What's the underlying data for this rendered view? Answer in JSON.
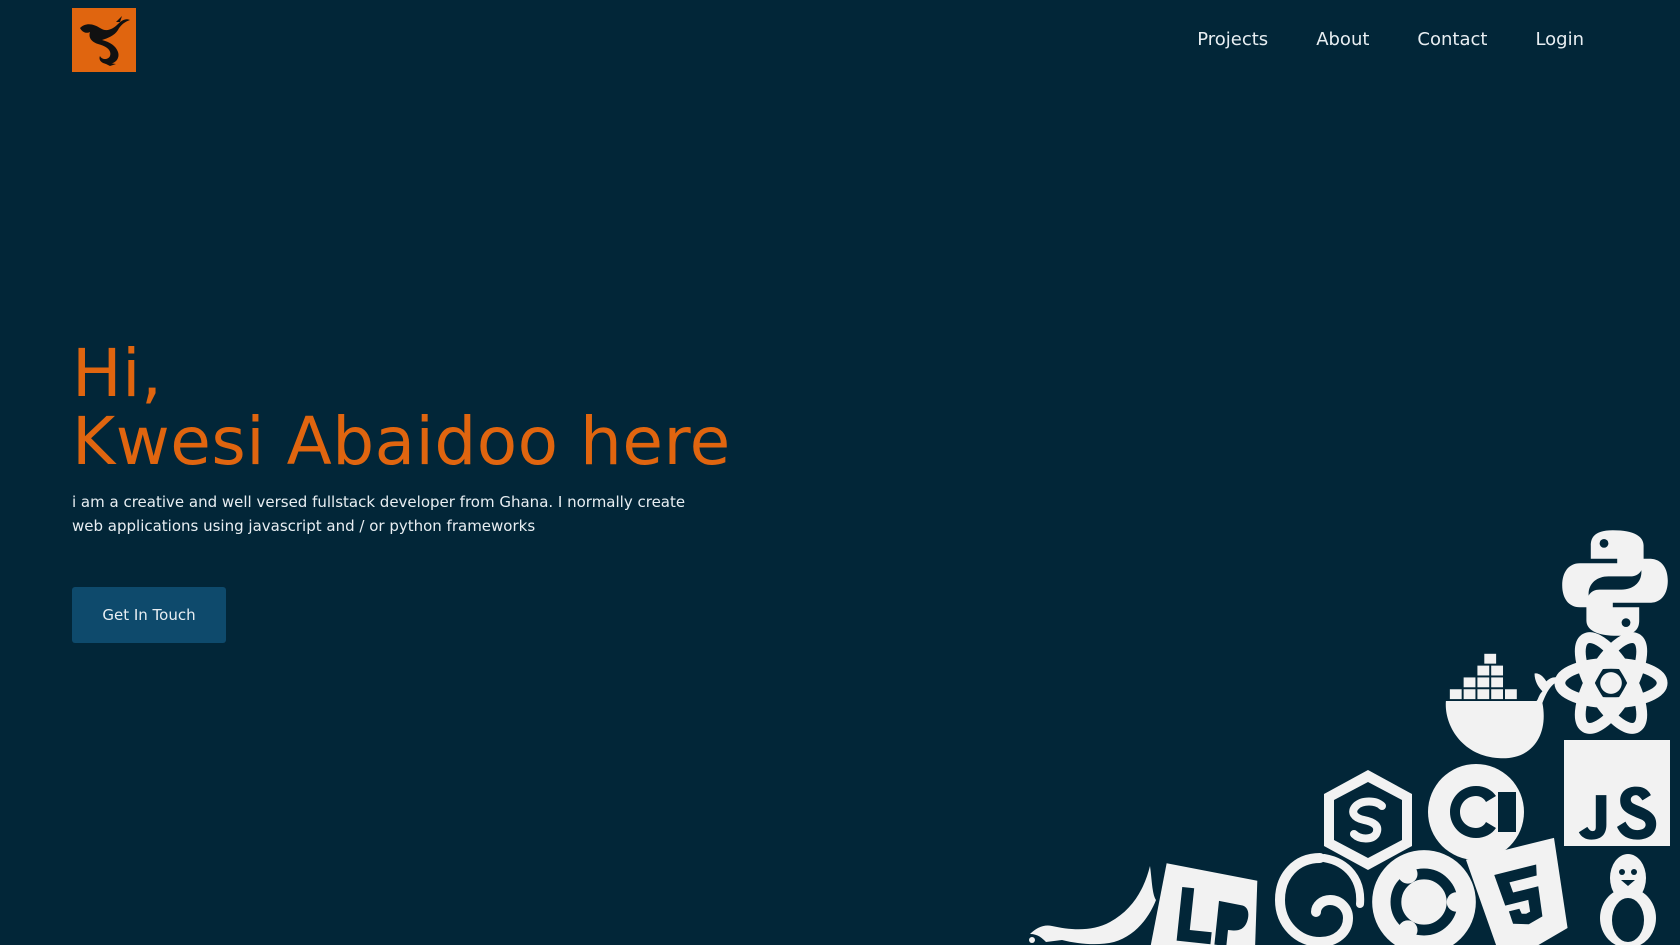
{
  "header": {
    "logo_icon": "dragon-logo-icon",
    "nav": [
      {
        "label": "Projects"
      },
      {
        "label": "About"
      },
      {
        "label": "Contact"
      },
      {
        "label": "Login"
      }
    ]
  },
  "hero": {
    "greeting": "Hi,",
    "headline": "Kwesi Abaidoo here",
    "description": "i am a creative and well versed fullstack developer from Ghana. I normally create web applications using javascript and / or python frameworks",
    "cta_label": "Get In Touch"
  },
  "tech_icons": [
    "python-icon",
    "react-icon",
    "docker-icon",
    "javascript-icon",
    "c-icon",
    "sass-icon",
    "linux-icon",
    "html5-icon",
    "ubuntu-icon",
    "debian-icon",
    "laravel-icon",
    "python-splash-icon"
  ],
  "colors": {
    "background": "#022638",
    "accent": "#e0650f",
    "button": "#0e4a6c",
    "text": "#e8eef2",
    "icon": "#f2f2f2"
  }
}
